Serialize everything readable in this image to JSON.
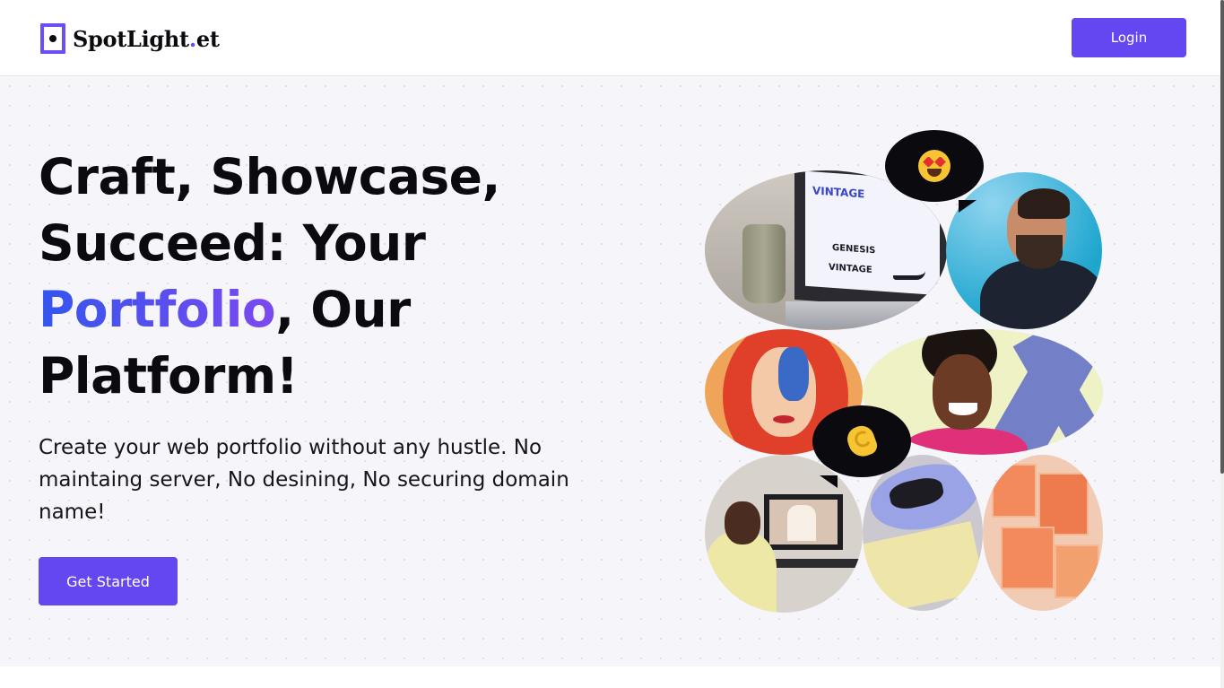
{
  "header": {
    "brand_name": "SpotLight",
    "brand_dot": ".",
    "brand_suffix": "et",
    "login_label": "Login"
  },
  "hero": {
    "headline_line1": "Craft, Showcase,",
    "headline_line2": "Succeed: Your",
    "headline_accent": "Portfolio",
    "headline_after_accent": ", Our",
    "headline_line4": "Platform!",
    "description": "Create your web portfolio without any hustle. No maintaing server, No desining, No securing domain name!",
    "cta_label": "Get Started"
  },
  "collage": {
    "photos": [
      "laptop-photo",
      "laughing-man-photo",
      "illustrated-woman-photo",
      "smiling-woman-photo",
      "designer-at-computer-photo",
      "tin-can-photo",
      "orange-boxes-photo"
    ],
    "bubble_top_icon": "heart-eyes-emoji-icon",
    "bubble_bottom_icon": "pinching-hand-emoji-icon",
    "laptop_screen_text": [
      "VINTAGE",
      "GENESIS",
      "VINTAGE"
    ]
  },
  "colors": {
    "accent": "#6547f2",
    "gradient_start": "#3455ee",
    "gradient_end": "#7b49f0",
    "hero_background": "#f5f5fa"
  }
}
